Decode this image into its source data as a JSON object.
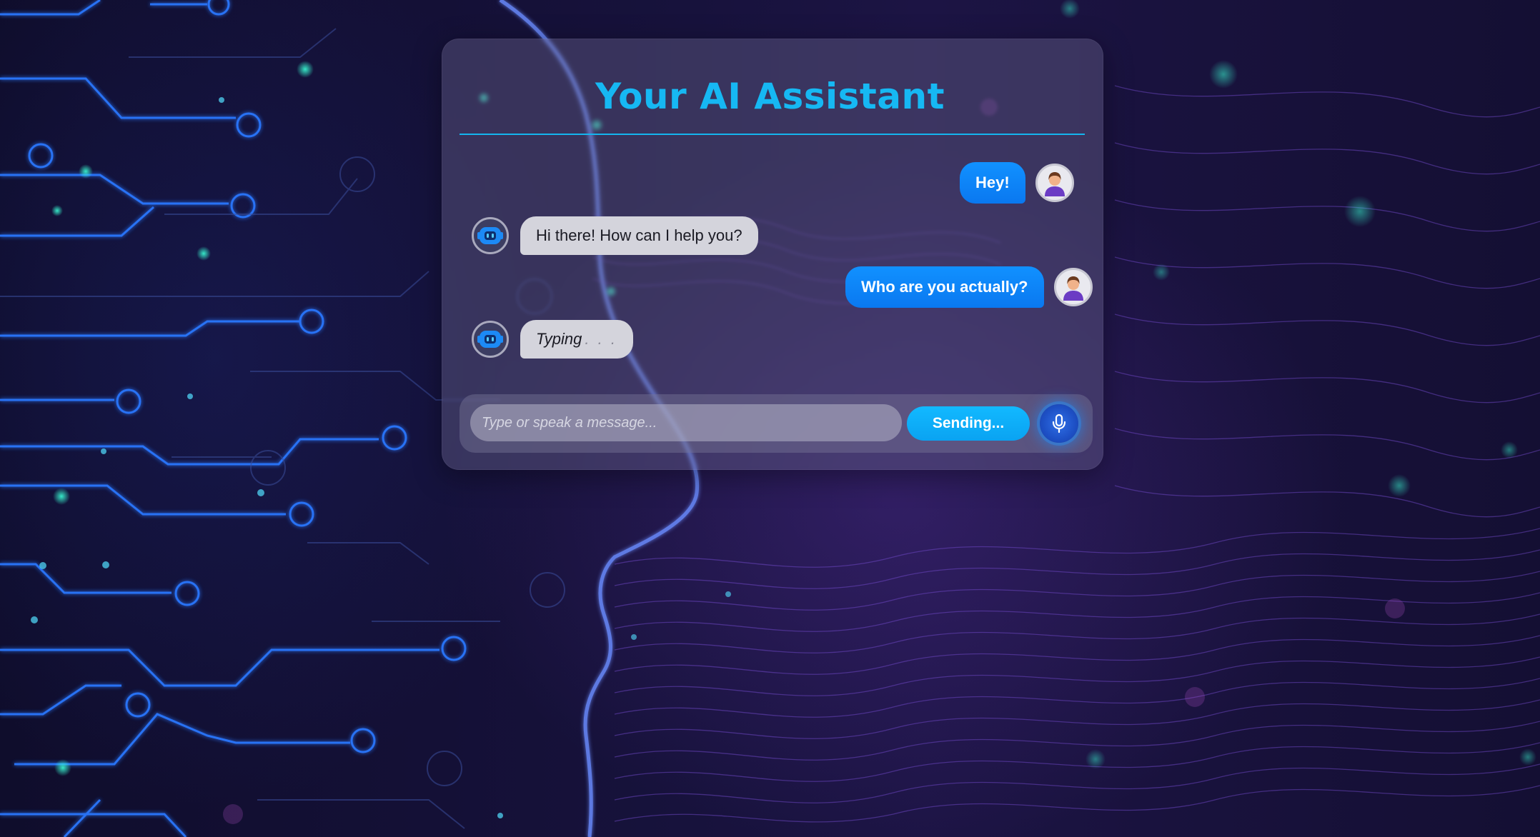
{
  "app": {
    "title": "Your AI Assistant"
  },
  "messages": [
    {
      "sender": "user",
      "text": "Hey!"
    },
    {
      "sender": "bot",
      "text": "Hi there! How can I help you?"
    },
    {
      "sender": "user",
      "text": "Who are you actually?"
    },
    {
      "sender": "bot",
      "text": "Typing",
      "dots": ". . ."
    }
  ],
  "composer": {
    "placeholder": "Type or speak a message...",
    "send_label": "Sending..."
  },
  "icons": {
    "user_avatar": "user-avatar-icon",
    "bot_avatar": "robot-icon",
    "mic": "microphone-icon"
  },
  "colors": {
    "accent": "#16b8f3",
    "user_bubble": "#0a82f5",
    "bot_bubble": "#d4d4dc",
    "send_button": "#10b0fa",
    "mic_button": "#2556d6"
  }
}
